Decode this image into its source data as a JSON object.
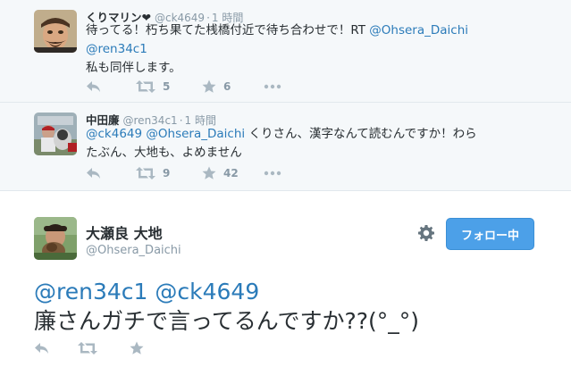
{
  "replies": [
    {
      "name": "くりマリン❤",
      "screen_name": "@ck4649",
      "separator": "·",
      "time": "1 時間",
      "line1_text": "待ってる！朽ち果てた桟橋付近で待ち合わせで！RT ",
      "line1_link": "@Ohsera_Daichi",
      "line2_link": "@ren34c1",
      "line3_text": "私も同伴します。",
      "retweet_count": "5",
      "favorite_count": "6"
    },
    {
      "name": "中田廉",
      "screen_name": "@ren34c1",
      "separator": "·",
      "time": "1 時間",
      "line1_link1": "@ck4649",
      "line1_link2": "@Ohsera_Daichi",
      "line1_text": " くりさん、漢字なんて読むんですか！わら",
      "line2_text": "たぶん、大地も、よめません",
      "retweet_count": "9",
      "favorite_count": "42"
    }
  ],
  "main_tweet": {
    "name": "大瀬良 大地",
    "screen_name": "@Ohsera_Daichi",
    "follow_label": "フォロー中",
    "text_link1": "@ren34c1",
    "text_link2": "@ck4649",
    "text_line2": "廉さんガチで言ってるんですか??(°_°)"
  },
  "colors": {
    "link": "#2b7bb9",
    "muted": "#8899a6",
    "follow_button": "#4ca0e8",
    "reply_background": "#f5f8fa"
  },
  "icons": [
    "reply-icon",
    "retweet-icon",
    "favorite-icon",
    "more-icon",
    "gear-icon"
  ]
}
